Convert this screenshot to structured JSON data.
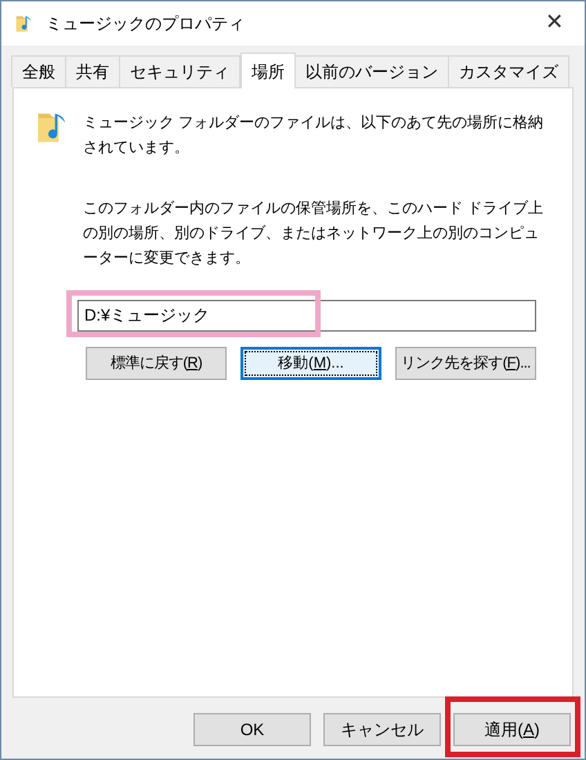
{
  "window": {
    "title": "ミュージックのプロパティ",
    "close": "✕"
  },
  "tabs": [
    {
      "label": "全般",
      "selected": false
    },
    {
      "label": "共有",
      "selected": false
    },
    {
      "label": "セキュリティ",
      "selected": false
    },
    {
      "label": "場所",
      "selected": true
    },
    {
      "label": "以前のバージョン",
      "selected": false
    },
    {
      "label": "カスタマイズ",
      "selected": false
    }
  ],
  "panel": {
    "intro": "ミュージック フォルダーのファイルは、以下のあて先の場所に格納されています。",
    "description": "このフォルダー内のファイルの保管場所を、このハード ドライブ上の別の場所、別のドライブ、またはネットワーク上の別のコンピューターに変更できます。",
    "path_field": {
      "value": "D:¥ミュージック",
      "highlighted": true
    },
    "buttons": [
      {
        "before": "標準に戻す(",
        "key": "R",
        "after": ")",
        "focused": false
      },
      {
        "before": "移動(",
        "key": "M",
        "after": ")...",
        "focused": true
      },
      {
        "before": "リンク先を探す(",
        "key": "F",
        "after": ")...",
        "focused": false
      }
    ]
  },
  "footer_buttons": [
    {
      "before": "OK",
      "highlighted": false
    },
    {
      "before": "キャンセル",
      "highlighted": false
    },
    {
      "before": "適用(",
      "key": "A",
      "after": ")",
      "highlighted": true
    }
  ]
}
